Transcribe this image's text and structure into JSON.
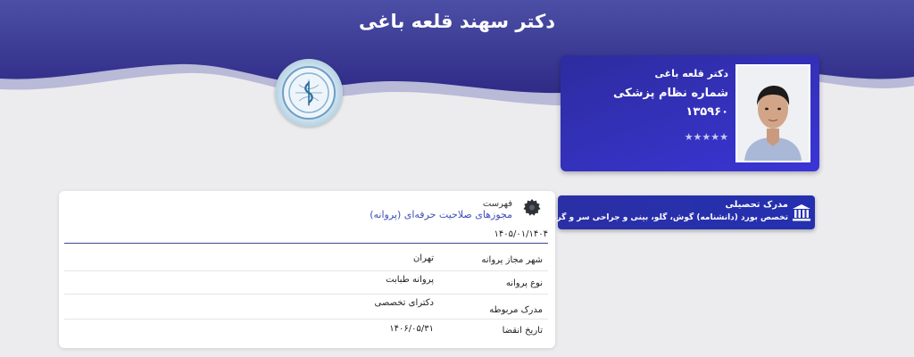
{
  "header": {
    "title": "دکتر سهند  قلعه باغی",
    "logo_icon": "medical-council-emblem-icon"
  },
  "profile": {
    "name": "دکتر قلعه باغی",
    "medical_number_label": "شماره نظام پزشکی",
    "medical_number": "۱۳۵۹۶۰",
    "rating_stars": "★★★★★",
    "rating": 5,
    "photo_icon": "doctor-photo"
  },
  "education": {
    "title": "مدرک تحصیلی",
    "detail": "تخصص بورد (دانشنامه) گوش، گلو، بینی و جراحی سر و گردن",
    "icon": "institution-icon"
  },
  "license": {
    "caption": "فهرست",
    "title": "مجوزهای صلاحیت حرفه‌ای (پروانه)",
    "date": "۱۴۰۵/۰۱/۱۴۰۴",
    "icon": "gear-badge-icon",
    "rows": [
      {
        "label": "شهر مجاز پروانه",
        "value": "تهران"
      },
      {
        "label": "نوع پروانه",
        "value": "پروانه طبابت"
      },
      {
        "label": "مدرک مربوطه",
        "value": "دکترای تخصصی"
      },
      {
        "label": "تاریخ انقضا",
        "value": "۱۴۰۶/۰۵/۳۱"
      }
    ]
  },
  "colors": {
    "header": "#3a3c9a",
    "card_accent": "#3a35d6",
    "link_title": "#3d4fb8",
    "background": "#ececef"
  }
}
